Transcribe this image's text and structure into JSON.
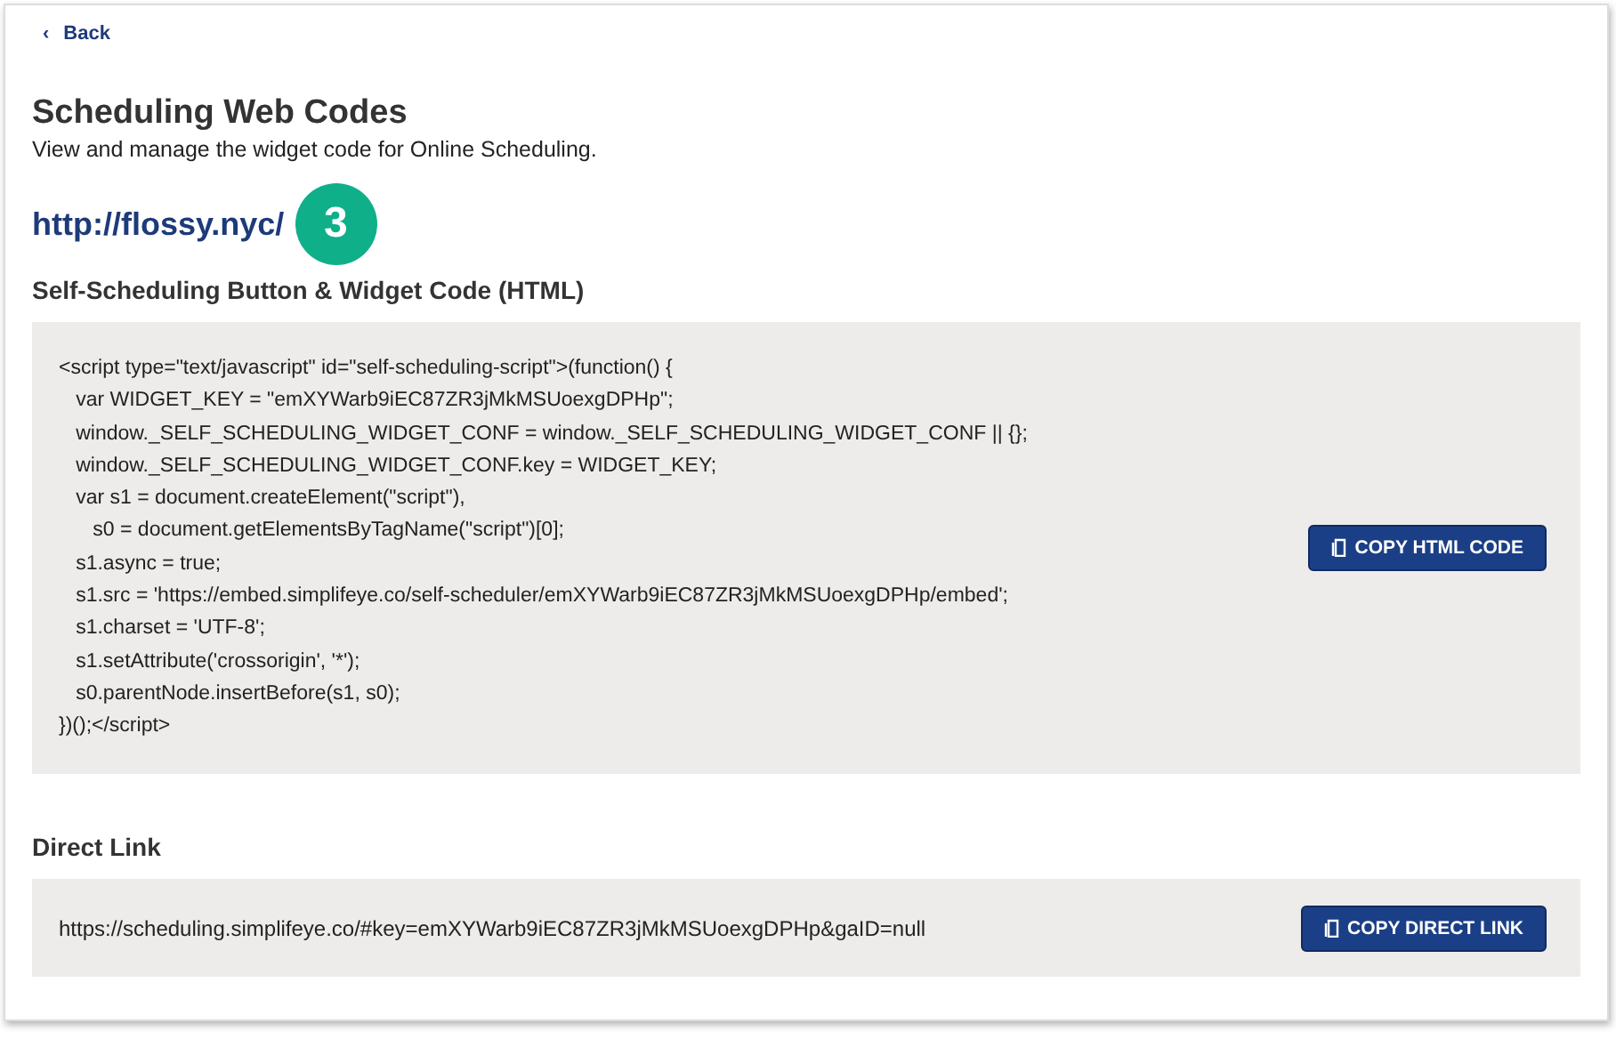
{
  "back_link": {
    "icon": "‹",
    "label": "Back"
  },
  "title": "Scheduling Web Codes",
  "subtitle": "View and manage the widget code for Online Scheduling.",
  "site_url": "http://flossy.nyc/",
  "step_badge": "3",
  "html_section": {
    "heading": "Self-Scheduling Button & Widget Code (HTML)",
    "code_lines": [
      "<script type=\"text/javascript\" id=\"self-scheduling-script\">(function() {",
      "   var WIDGET_KEY = \"emXYWarb9iEC87ZR3jMkMSUoexgDPHp\";",
      "   window._SELF_SCHEDULING_WIDGET_CONF = window._SELF_SCHEDULING_WIDGET_CONF || {};",
      "   window._SELF_SCHEDULING_WIDGET_CONF.key = WIDGET_KEY;",
      "   var s1 = document.createElement(\"script\"),",
      "      s0 = document.getElementsByTagName(\"script\")[0];",
      "   s1.async = true;",
      "   s1.src = 'https://embed.simplifeye.co/self-scheduler/emXYWarb9iEC87ZR3jMkMSUoexgDPHp/embed';",
      "   s1.charset = 'UTF-8';",
      "   s1.setAttribute('crossorigin', '*');",
      "   s0.parentNode.insertBefore(s1, s0);",
      "})();</script>"
    ],
    "button": "COPY HTML CODE"
  },
  "direct_link_section": {
    "heading": "Direct Link",
    "url": "https://scheduling.simplifeye.co/#key=emXYWarb9iEC87ZR3jMkMSUoexgDPHp&gaID=null",
    "button": "COPY DIRECT LINK"
  }
}
